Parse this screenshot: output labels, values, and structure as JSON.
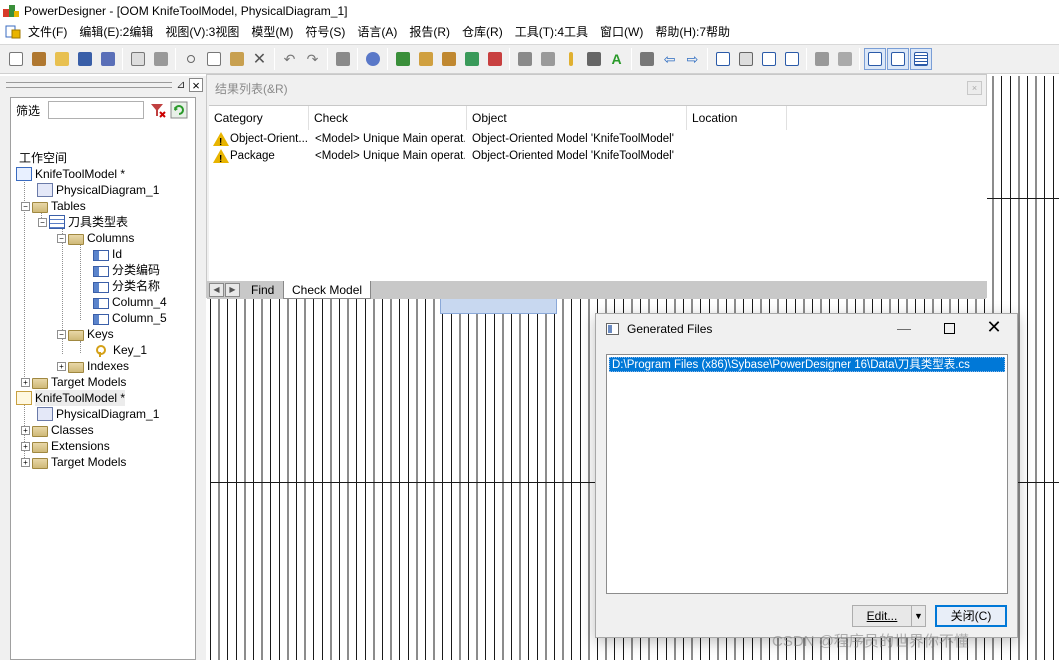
{
  "window": {
    "title": "PowerDesigner - [OOM KnifeToolModel, PhysicalDiagram_1]"
  },
  "menu": [
    "文件(F)",
    "编辑(E):2编辑",
    "视图(V):3视图",
    "模型(M)",
    "符号(S)",
    "语言(A)",
    "报告(R)",
    "仓库(R)",
    "工具(T):4工具",
    "窗口(W)",
    "帮助(H):7帮助"
  ],
  "browser": {
    "filter_label": "筛选",
    "filter_value": "",
    "tree": [
      {
        "label": "工作空间"
      },
      {
        "label": "KnifeToolModel *"
      },
      {
        "label": "PhysicalDiagram_1"
      },
      {
        "label": "Tables"
      },
      {
        "label": "刀具类型表"
      },
      {
        "label": "Columns"
      },
      {
        "label": "Id"
      },
      {
        "label": "分类编码"
      },
      {
        "label": "分类名称"
      },
      {
        "label": "Column_4"
      },
      {
        "label": "Column_5"
      },
      {
        "label": "Keys"
      },
      {
        "label": "Key_1"
      },
      {
        "label": "Indexes"
      },
      {
        "label": "Target Models"
      },
      {
        "label": "KnifeToolModel *"
      },
      {
        "label": "PhysicalDiagram_1"
      },
      {
        "label": "Classes"
      },
      {
        "label": "Extensions"
      },
      {
        "label": "Target Models"
      }
    ]
  },
  "results": {
    "caption": "结果列表(&R)",
    "columns": [
      "Category",
      "Check",
      "Object",
      "Location"
    ],
    "rows": [
      {
        "category": "Object-Orient...",
        "check": "<Model> Unique Main operat...",
        "object": "Object-Oriented Model 'KnifeToolModel'",
        "location": ""
      },
      {
        "category": "Package",
        "check": "<Model> Unique Main operat...",
        "object": "Object-Oriented Model 'KnifeToolModel'",
        "location": ""
      }
    ],
    "tabs": [
      "Find",
      "Check Model"
    ]
  },
  "generated_files": {
    "title": "Generated Files",
    "items": [
      "D:\\Program Files (x86)\\Sybase\\PowerDesigner 16\\Data\\刀具类型表.cs"
    ],
    "edit_label": "Edit...",
    "close_label": "关闭(C)"
  },
  "watermark": "CSDN @程序员的世界你不懂",
  "colors": {
    "selection": "#0078d7",
    "warning": "#e8b400"
  }
}
